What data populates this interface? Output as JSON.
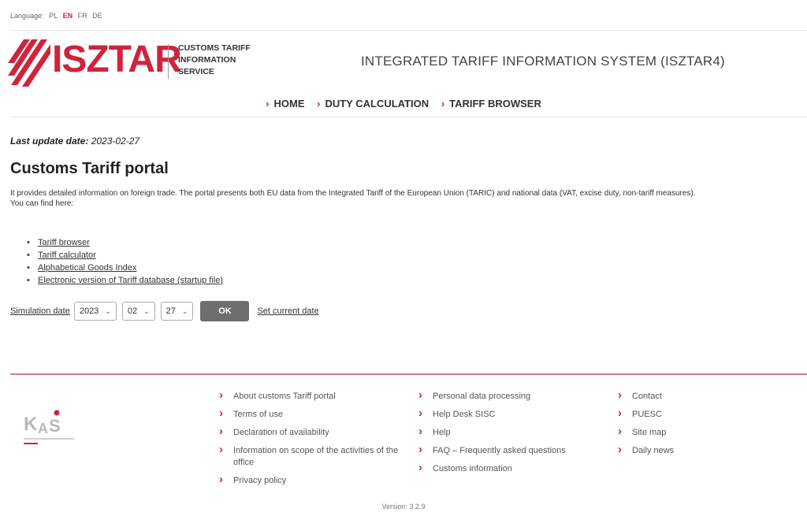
{
  "language": {
    "label": "Language:",
    "options": [
      "PL",
      "EN",
      "FR",
      "DE"
    ],
    "active": "EN"
  },
  "logo": {
    "word": "ISZTAR",
    "subtitle_lines": [
      "CUSTOMS TARIFF",
      "INFORMATION",
      "SERVICE"
    ],
    "brand_color": "#d0233c"
  },
  "header": {
    "system_title": "INTEGRATED TARIFF INFORMATION SYSTEM (ISZTAR4)"
  },
  "nav": {
    "items": [
      {
        "label": "HOME"
      },
      {
        "label": "DUTY CALCULATION"
      },
      {
        "label": "TARIFF BROWSER"
      }
    ]
  },
  "main": {
    "last_update_label": "Last update date:",
    "last_update_value": "2023-02-27",
    "title": "Customs Tariff portal",
    "description": "It provides detailed information on foreign trade. The portal presents both EU data from the Integrated Tariff of the European Union (TARIC) and national data (VAT, excise duty, non-tariff measures).",
    "find_here": "You can find here:",
    "links": [
      "Tariff browser",
      "Tariff calculator",
      "Alphabetical Goods Index",
      "Electronic version of Tariff database (startup file)"
    ]
  },
  "simulation": {
    "label": "Simulation date",
    "year": "2023",
    "month": "02",
    "day": "27",
    "ok_label": "OK",
    "set_current_label": "Set current date"
  },
  "footer": {
    "col1": [
      "About customs Tariff portal",
      "Terms of use",
      "Declaration of availability",
      "Information on scope of the activities of the office",
      "Privacy policy"
    ],
    "col2": [
      "Personal data processing",
      "Help Desk SISC",
      "Help",
      "FAQ – Frequently asked questions",
      "Customs information"
    ],
    "col3": [
      "Contact",
      "PUESC",
      "Site map",
      "Daily news"
    ],
    "version": "Version: 3.2.9"
  }
}
